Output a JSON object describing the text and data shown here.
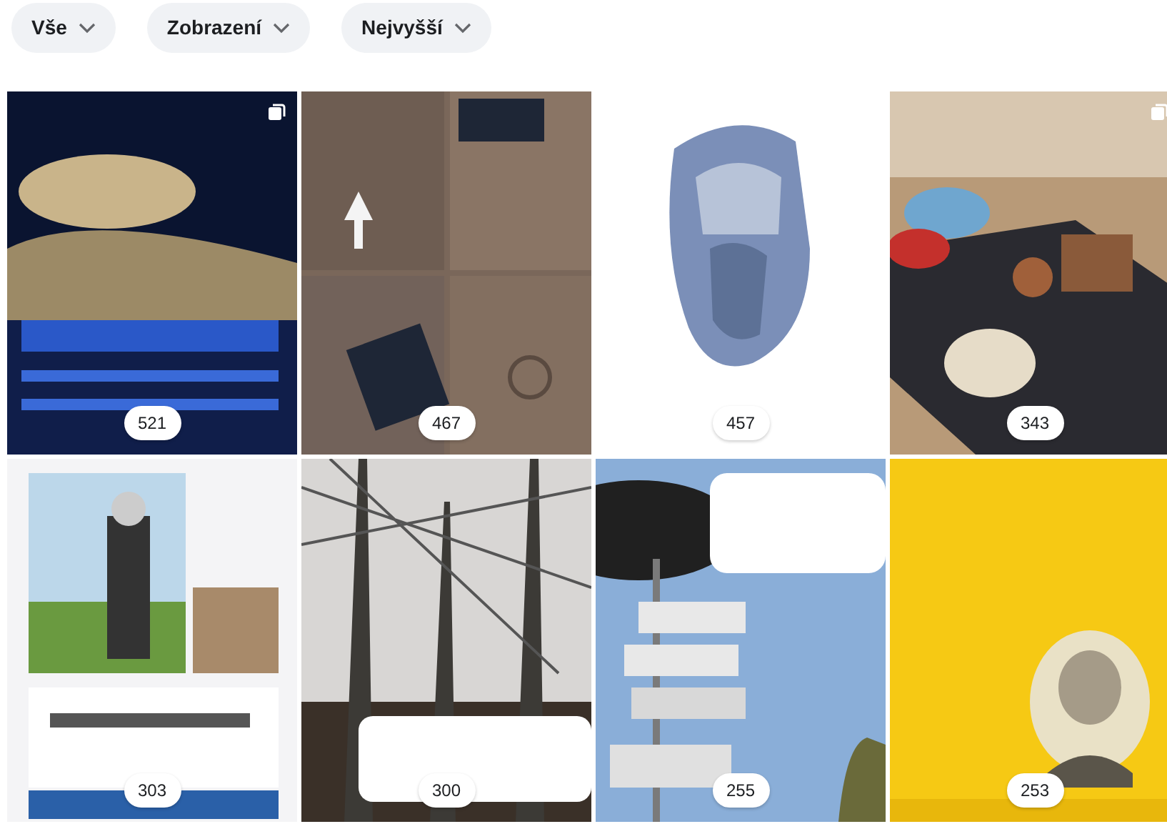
{
  "filters": [
    {
      "label": "Vše"
    },
    {
      "label": "Zobrazení"
    },
    {
      "label": "Nejvyšší"
    }
  ],
  "photos": [
    {
      "kind": "picture",
      "count": "521",
      "multiple": true
    },
    {
      "kind": "picture",
      "count": "467",
      "multiple": false
    },
    {
      "kind": "picture",
      "count": "457",
      "multiple": false
    },
    {
      "kind": "picture",
      "count": "343",
      "multiple": true
    },
    {
      "kind": "picture",
      "count": "303",
      "multiple": false
    },
    {
      "kind": "picture",
      "count": "300",
      "multiple": false
    },
    {
      "kind": "picture",
      "count": "255",
      "multiple": false
    },
    {
      "kind": "picture",
      "count": "253",
      "multiple": false
    }
  ]
}
